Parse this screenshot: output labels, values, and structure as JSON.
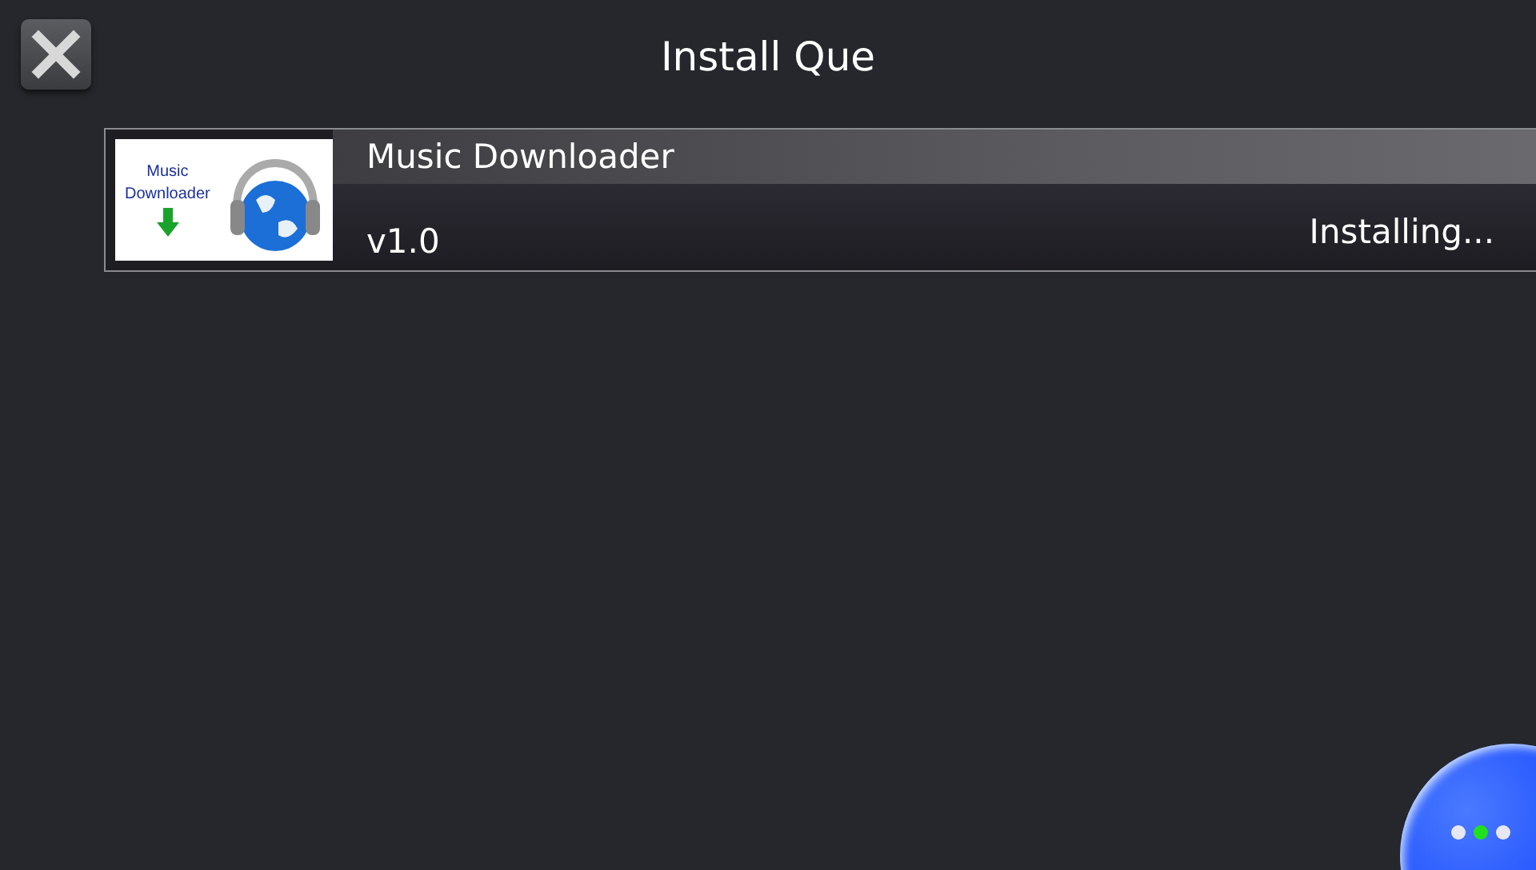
{
  "header": {
    "title": "Install Que"
  },
  "queue": [
    {
      "name": "Music Downloader",
      "version": "v1.0",
      "status": "Installing...",
      "thumbnail_text": [
        "Music",
        "Downloader"
      ]
    }
  ],
  "page_dots": [
    {
      "selected": false
    },
    {
      "selected": true
    },
    {
      "selected": false
    }
  ]
}
